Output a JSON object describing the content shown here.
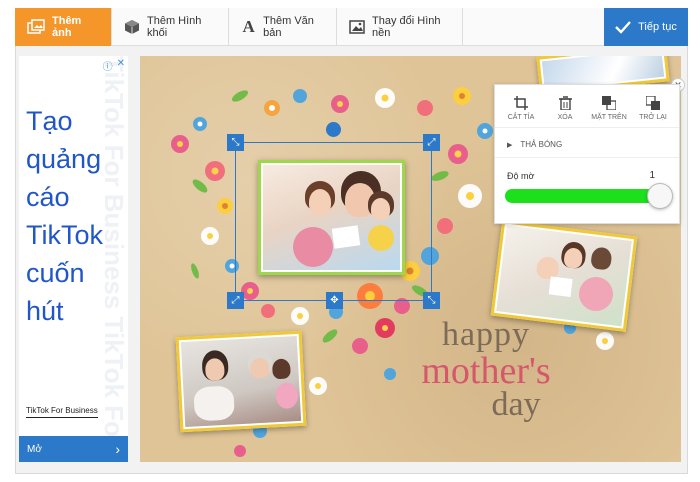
{
  "toolbar": {
    "items": [
      {
        "label": "Thêm ảnh",
        "icon": "images-icon",
        "active": true
      },
      {
        "label": "Thêm Hình khối",
        "icon": "cube-icon"
      },
      {
        "label": "Thêm Văn bản",
        "icon": "text-icon"
      },
      {
        "label": "Thay đổi Hình nền",
        "icon": "background-image-icon"
      }
    ],
    "next_label": "Tiếp tục"
  },
  "ad": {
    "headline": [
      "Tạo",
      "quảng",
      "cáo",
      "TikTok",
      "cuốn",
      "hút"
    ],
    "watermark": "TikTok For Business TikTok For",
    "brand": "TikTok For Business",
    "cta": "Mở",
    "cta_arrow": "›"
  },
  "panel": {
    "actions": [
      {
        "label": "CẮT TỈA",
        "icon": "crop-icon"
      },
      {
        "label": "XÓA",
        "icon": "trash-icon"
      },
      {
        "label": "MẶT TRÊN",
        "icon": "bring-front-icon"
      },
      {
        "label": "TRỞ LẠI",
        "icon": "send-back-icon"
      }
    ],
    "shadow_label": "THẢ BÓNG",
    "opacity_label": "Độ mờ",
    "opacity_value": "1",
    "opacity_fraction": 1.0
  },
  "card_text": {
    "line1": "happy",
    "line2": "mother's",
    "line3": "day"
  },
  "colors": {
    "orange": "#f5962a",
    "blue": "#2c78c9",
    "green": "#1be01b",
    "pink": "#d6566b"
  }
}
